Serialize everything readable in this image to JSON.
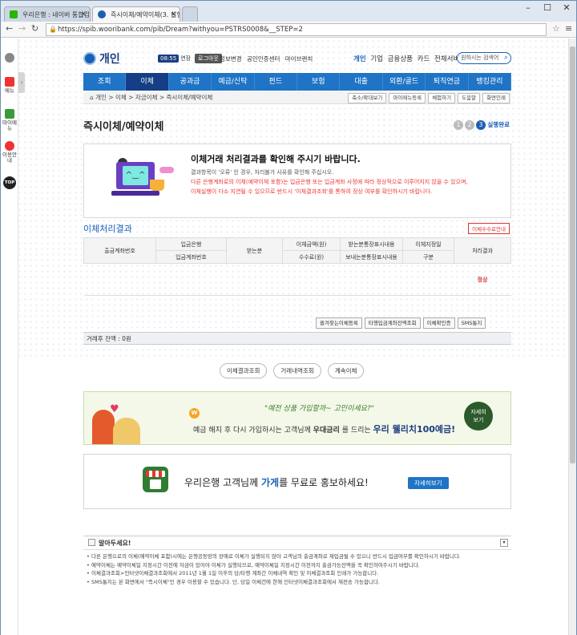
{
  "browser": {
    "tabs": [
      {
        "label": "우리은행 : 네이버 통합검",
        "fav_color": "#2db400"
      },
      {
        "label": "즉시이체/예약이체(3. 실행",
        "fav_color": "#1a5fb4"
      }
    ],
    "url": "https://spib.wooribank.com/pib/Dream?withyou=PSTRS0008&__STEP=2"
  },
  "left_sidebar": [
    {
      "label": "메뉴"
    },
    {
      "label": "마이메뉴"
    },
    {
      "label": "이용안내"
    },
    {
      "label": "TOP"
    }
  ],
  "header": {
    "logo": "개인",
    "time": "08:55",
    "extend": "연장",
    "logout": "로그아웃",
    "util_links": "정보변경 공인인증센터 마이브랜치",
    "right_links_active": "개인",
    "right_links": "기업 금융상품 카드 전체서비스 ▾",
    "search_placeholder": "원하시는 검색어",
    "brand_color": "#1f74c6"
  },
  "gnb": [
    "조회",
    "이체",
    "공과금",
    "예금/신탁",
    "펀드",
    "보험",
    "대출",
    "외환/골드",
    "퇴직연금",
    "뱅킹관리"
  ],
  "breadcrumb": "개인 > 이체 > 자금이체 > 즉시이체/예약이체",
  "crumb_buttons": [
    "축소/확대보기",
    "마이메뉴등록",
    "체험하기",
    "도움말",
    "화면인쇄"
  ],
  "page_title": "즉시이체/예약이체",
  "steps": {
    "s1": "1",
    "s2": "2",
    "s3": "3",
    "label": "실행완료"
  },
  "message": {
    "title": "이체거래 처리결과를 확인해 주시기 바랍니다.",
    "line1": "결과항목이 '오류' 인 경우, 처리불가 사유를 확인해 주십시오.",
    "line2": "다른 은행계좌로의 이체(예약이체 포함)는 입금은행 또는 입금계좌 사정에 따라 정상적으로 이루어지지 않을 수 있으며,",
    "line3": "이체실행이 다소 지연될 수 있으므로 반드시 '이체결과조회'를 통하여 정상 여부를 확인하시기 바랍니다."
  },
  "result_section": {
    "title": "이체처리결과",
    "fee_button": "이체수수료안내",
    "headers": {
      "from_account": "출금계좌번호",
      "bank": "입금은행",
      "to_account": "입금계좌번호",
      "receiver": "받는분",
      "amount": "이체금액(원)",
      "fee": "수수료(원)",
      "recv_memo": "받는분통장표시내용",
      "send_memo": "보내는분통장표시내용",
      "schedule": "이체지정일",
      "type": "구분",
      "result": "처리결과"
    },
    "row": {
      "result": "정상"
    }
  },
  "action_buttons": [
    "즐겨찾는이체등록",
    "타행입금계좌잔액조회",
    "이체확인증",
    "SMS통지"
  ],
  "balance": "거래후 잔액 : 0원",
  "bottom_buttons": [
    "이체결과조회",
    "거래내역조회",
    "계속이체"
  ],
  "banner1": {
    "quote": "\"예전 상품 가입할까~ 고민이세요?\"",
    "w": "W",
    "ad_pre": "예금 해지 후 다시 가입하시는 고객님께",
    "ad_bold": "우대금리",
    "ad_mid": "를 드리는",
    "ad_product": "우리 웰리치100예금!",
    "more": "자세히\n보기"
  },
  "banner2": {
    "txt_pre": "우리은행 고객님께",
    "txt_b": "가게",
    "txt_post": "를 무료로 홍보하세요!",
    "btn": "자세히보기"
  },
  "notice": {
    "title": "알아두세요!",
    "items": [
      "다른 은행으로의 이체(예약이체 포함)시에는 은행공동망의 장애로 이체가 실행되지 않아 고객님의 출금계좌로 재입금될 수 있으니 반드시 입금여부를 확인하시기 바랍니다.",
      "예약이체는 예약이체일 지정시간 이전에 자금이 있어야 이체가 실행되므로, 예약이체일 지정시간 이전까지 출금가능잔액을 꼭 확인하여주시기 바랍니다.",
      "이체결과조회>인터넷이체결과조회에서 2011년 1월 1일 이후의 당/타행 계좌간 이체내역 확인 및 이체결과조회 인쇄가 가능합니다.",
      "SMS통지는 본 화면에서 \"즉시이체\"인 경우 이용할 수 있습니다. 단, 당일 이체건에 한해 인터넷이체결과조회에서 재전송 가능합니다."
    ]
  }
}
